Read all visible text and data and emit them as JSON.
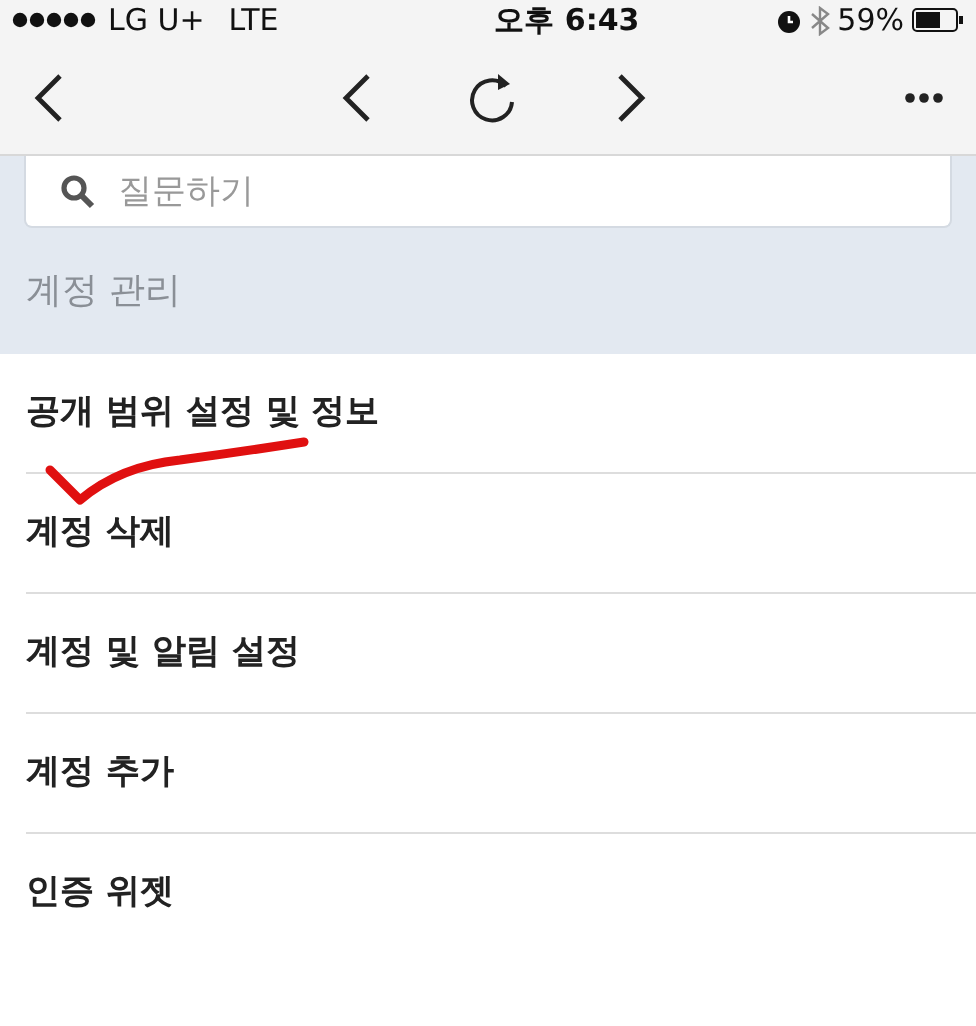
{
  "status_bar": {
    "carrier": "LG U+",
    "network": "LTE",
    "time": "오후 6:43",
    "battery": "59%"
  },
  "search": {
    "placeholder": "질문하기"
  },
  "section": {
    "title": "계정 관리"
  },
  "items": [
    {
      "label": "공개 범위 설정 및 정보"
    },
    {
      "label": "계정 삭제"
    },
    {
      "label": "계정 및 알림 설정"
    },
    {
      "label": "계정 추가"
    },
    {
      "label": "인증 위젯"
    }
  ]
}
